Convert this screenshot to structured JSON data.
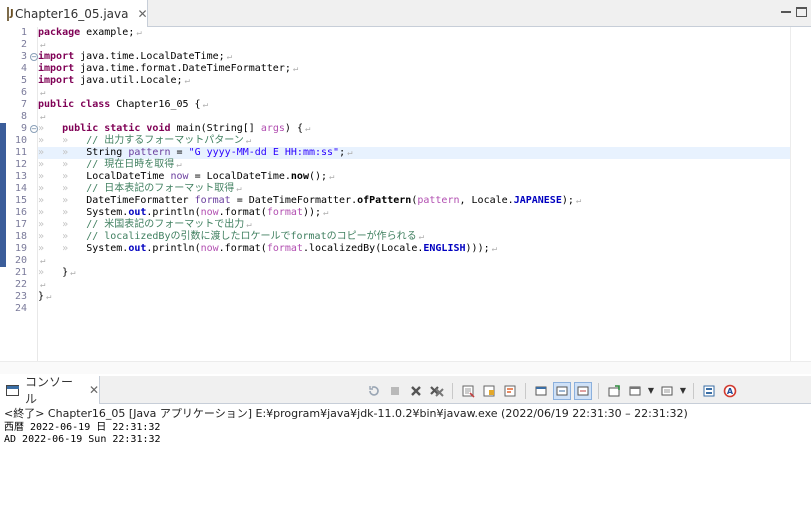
{
  "editor": {
    "tab_label": "Chapter16_05.java",
    "tab_close": "✕",
    "line_numbers": [
      "1",
      "2",
      "3",
      "4",
      "5",
      "6",
      "7",
      "8",
      "9",
      "10",
      "11",
      "12",
      "13",
      "14",
      "15",
      "16",
      "17",
      "18",
      "19",
      "20",
      "21",
      "22",
      "23",
      "24"
    ]
  },
  "code": {
    "l1_kw": "package",
    "l1_rest": " example;",
    "l3_kw": "import",
    "l3_rest": " java.time.LocalDateTime;",
    "l4_kw": "import",
    "l4_rest": " java.time.format.DateTimeFormatter;",
    "l5_kw": "import",
    "l5_rest": " java.util.Locale;",
    "l7_kw1": "public",
    "l7_kw2": "class",
    "l7_rest": " Chapter16_05 {",
    "l9_kw1": "public",
    "l9_kw2": "static",
    "l9_kw3": "void",
    "l9_rest": " main(String[] ",
    "l9_param": "args",
    "l9_end": ") {",
    "l10_comment": "// 出力するフォーマットパターン",
    "l11_type": "String ",
    "l11_var": "pattern",
    "l11_eq": " = ",
    "l11_str": "\"G yyyy-MM-dd E HH:mm:ss\"",
    "l11_end": ";",
    "l12_comment": "// 現在日時を取得",
    "l13_type": "LocalDateTime ",
    "l13_var": "now",
    "l13_mid": " = LocalDateTime.",
    "l13_method": "now",
    "l13_end": "();",
    "l14_comment": "// 日本表記のフォーマット取得",
    "l15_type": "DateTimeFormatter ",
    "l15_var": "format",
    "l15_mid": " = DateTimeFormatter.",
    "l15_method": "ofPattern",
    "l15_open": "(",
    "l15_arg": "pattern",
    "l15_mid2": ", Locale.",
    "l15_const": "JAPANESE",
    "l15_end": ");",
    "l16_a": "System.",
    "l16_out": "out",
    "l16_b": ".println(",
    "l16_now": "now",
    "l16_c": ".format(",
    "l16_fmt": "format",
    "l16_end": "));",
    "l17_comment": "// 米国表記のフォーマットで出力",
    "l18_comment": "// localizedByの引数に渡したロケールでformatのコピーが作られる",
    "l19_a": "System.",
    "l19_out": "out",
    "l19_b": ".println(",
    "l19_now": "now",
    "l19_c": ".format(",
    "l19_fmt": "format",
    "l19_d": ".localizedBy(Locale.",
    "l19_const": "ENGLISH",
    "l19_end": ")));",
    "l21_rest": "}",
    "l23_rest": "}",
    "eol": "↵",
    "tab": "»"
  },
  "console": {
    "tab_label": "コンソール",
    "tab_close": "✕",
    "header": "<終了> Chapter16_05 [Java アプリケーション] E:¥program¥java¥jdk-11.0.2¥bin¥javaw.exe (2022/06/19 22:31:30 – 22:31:32)",
    "output": [
      "西暦 2022-06-19 日 22:31:32",
      "AD 2022-06-19 Sun 22:31:32"
    ]
  },
  "toolbar_icons": [
    "relaunch-icon",
    "terminate-icon",
    "remove-launch-icon",
    "remove-all-terminated-icon",
    "clear-console-icon",
    "scroll-lock-icon",
    "word-wrap-icon",
    "show-on-stdout-icon",
    "show-on-stderr-icon",
    "pin-console-icon",
    "display-console-icon",
    "new-console-icon",
    "open-console-icon"
  ],
  "colors": {
    "keyword": "#7f0055",
    "string": "#2a00ff",
    "comment": "#3f7f5f",
    "static_field": "#0000c0",
    "local_variable": "#6a3e9e",
    "parameter": "#b24fb1",
    "current_line": "#e8f2fe",
    "line_number": "#7b7b9b"
  }
}
